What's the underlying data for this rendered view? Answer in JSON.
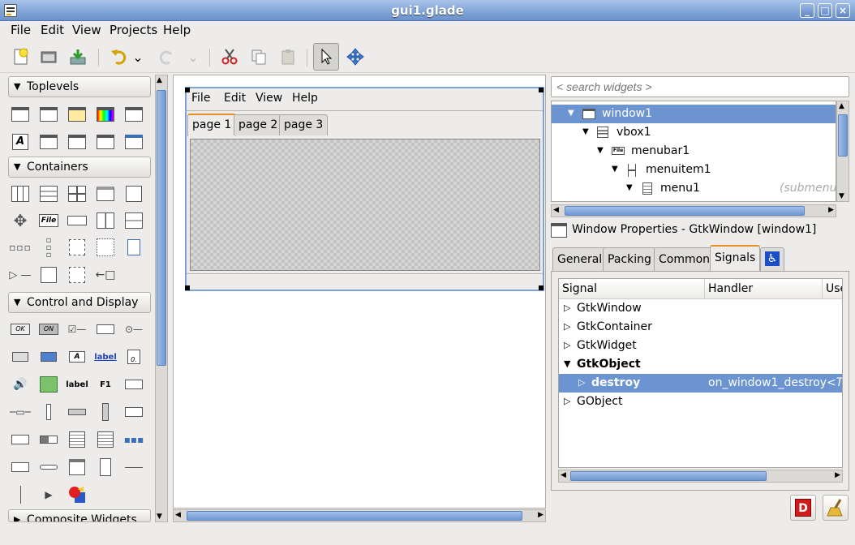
{
  "window": {
    "title": "gui1.glade",
    "min_label": "_",
    "max_label": "□",
    "close_label": "×"
  },
  "menubar": {
    "file": "File",
    "edit": "Edit",
    "view": "View",
    "projects": "Projects",
    "help": "Help"
  },
  "toolbar": {
    "dropdown_glyph": "⌄"
  },
  "palette": {
    "groups": {
      "toplevels": "Toplevels",
      "containers": "Containers",
      "control_display": "Control and Display",
      "composite": "Composite Widgets"
    },
    "icon_texts": {
      "ok": "OK",
      "on": "ON",
      "label_link": "label",
      "label": "label",
      "a": "A",
      "file": "File",
      "f1": "F1",
      "zero": "0."
    }
  },
  "design": {
    "menu": {
      "file": "File",
      "edit": "Edit",
      "view": "View",
      "help": "Help"
    },
    "tabs": [
      "page 1",
      "page 2",
      "page 3"
    ]
  },
  "search": {
    "placeholder": "< search widgets >"
  },
  "tree": {
    "items": [
      {
        "label": "window1",
        "selected": true
      },
      {
        "label": "vbox1"
      },
      {
        "label": "menubar1"
      },
      {
        "label": "menuitem1"
      },
      {
        "label": "menu1",
        "note": "(submenu"
      }
    ]
  },
  "properties": {
    "title": "Window Properties - GtkWindow [window1]",
    "tabs": [
      "General",
      "Packing",
      "Common",
      "Signals"
    ],
    "active_tab": "Signals",
    "columns": {
      "signal": "Signal",
      "handler": "Handler",
      "user": "Use"
    },
    "rows": [
      {
        "signal": "GtkWindow",
        "handler": "",
        "user": ""
      },
      {
        "signal": "GtkContainer",
        "handler": "",
        "user": ""
      },
      {
        "signal": "GtkWidget",
        "handler": "",
        "user": ""
      },
      {
        "signal": "GtkObject",
        "handler": "",
        "user": ""
      },
      {
        "signal": "destroy",
        "handler": "on_window1_destroy",
        "user": "<T"
      },
      {
        "signal": "GObject",
        "handler": "",
        "user": ""
      }
    ]
  },
  "colors": {
    "selection": "#6b94d0",
    "titlebar": "#7ea3d6"
  }
}
